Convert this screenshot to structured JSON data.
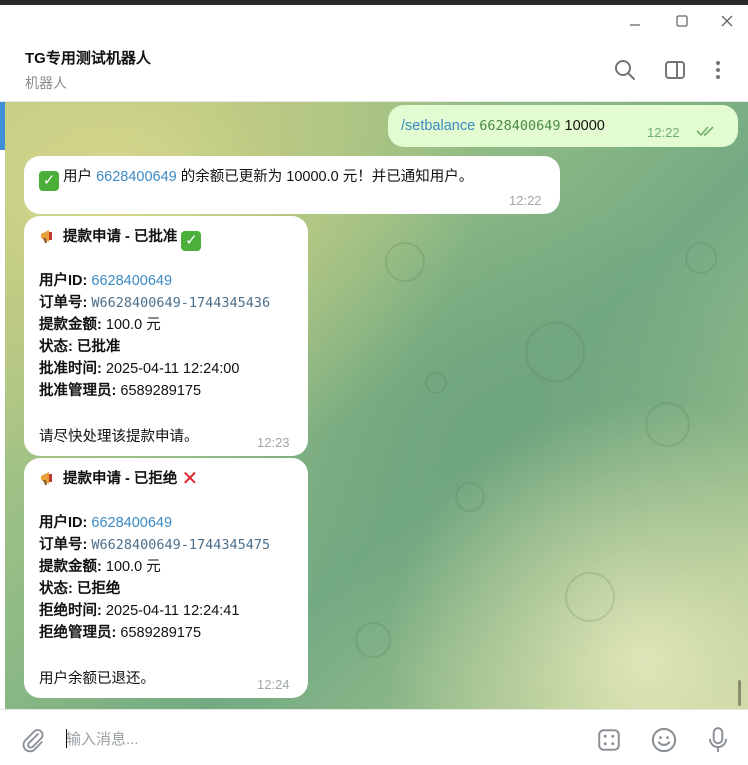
{
  "window": {
    "minimize_icon": "minimize-icon",
    "maximize_icon": "maximize-icon",
    "close_icon": "close-icon"
  },
  "header": {
    "title": "TG专用测试机器人",
    "subtitle": "机器人",
    "icons": [
      "search-icon",
      "sidebar-toggle-icon",
      "more-vertical-icon"
    ]
  },
  "messages": {
    "m1": {
      "command": "/setbalance",
      "user_id": "6628400649",
      "amount": "10000",
      "time": "12:22",
      "status": "read"
    },
    "m2": {
      "prefix": "用户",
      "user_id": "6628400649",
      "text": "的余额已更新为 10000.0 元！并已通知用户。",
      "time": "12:22"
    },
    "m3": {
      "title": "提款申请 - 已批准",
      "user_id_label": "用户ID:",
      "user_id": "6628400649",
      "order_label": "订单号:",
      "order": "W6628400649-1744345436",
      "amount_label": "提款金额:",
      "amount": "100.0 元",
      "status_label": "状态:",
      "status": "已批准",
      "time_label": "批准时间:",
      "time_value": "2025-04-11 12:24:00",
      "admin_label": "批准管理员:",
      "admin": "6589289175",
      "footer": "请尽快处理该提款申请。",
      "time": "12:23"
    },
    "m4": {
      "title": "提款申请 - 已拒绝",
      "user_id_label": "用户ID:",
      "user_id": "6628400649",
      "order_label": "订单号:",
      "order": "W6628400649-1744345475",
      "amount_label": "提款金额:",
      "amount": "100.0 元",
      "status_label": "状态:",
      "status": "已拒绝",
      "time_label": "拒绝时间:",
      "time_value": "2025-04-11 12:24:41",
      "admin_label": "拒绝管理员:",
      "admin": "6589289175",
      "footer": "用户余额已退还。",
      "time": "12:24"
    }
  },
  "composer": {
    "placeholder": "输入消息...",
    "icons": [
      "attach-icon",
      "bot-commands-icon",
      "emoji-icon",
      "microphone-icon"
    ]
  },
  "colors": {
    "link": "#3a8ac4",
    "outgoing_bubble": "#e3fbd0",
    "incoming_bubble": "#ffffff",
    "accent": "#3e8ed8"
  }
}
